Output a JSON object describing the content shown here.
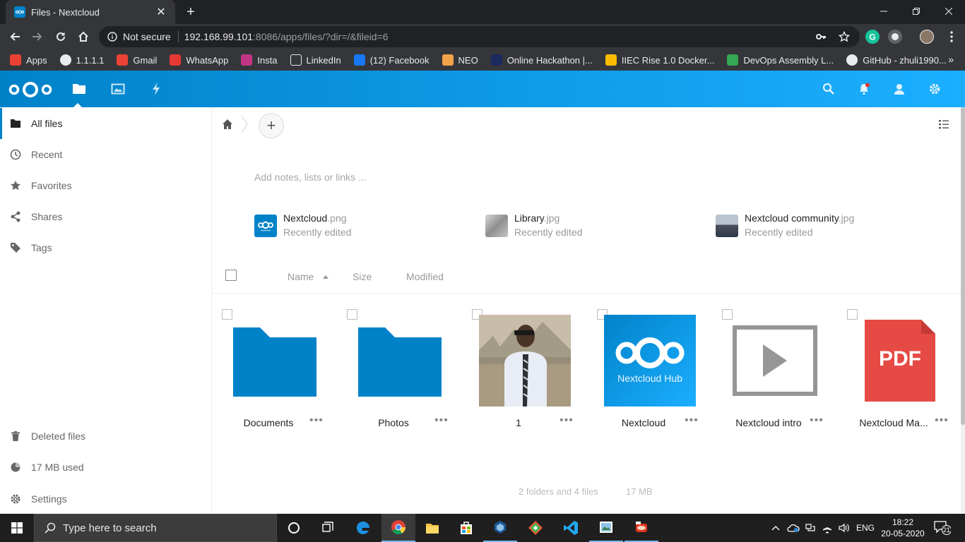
{
  "browser": {
    "tab_title": "Files - Nextcloud",
    "tab_close": "✕",
    "new_tab": "+",
    "security_label": "Not secure",
    "url_host": "192.168.99.101",
    "url_rest": ":8086/apps/files/?dir=/&fileid=6",
    "bookmarks": [
      {
        "label": "Apps",
        "icon": "apps-grid-icon",
        "color": "#e94235"
      },
      {
        "label": "1.1.1.1",
        "icon": "globe-icon",
        "color": "#e8eaed"
      },
      {
        "label": "Gmail",
        "icon": "gmail-icon",
        "color": "#ea4335"
      },
      {
        "label": "WhatsApp",
        "icon": "whatsapp-icon",
        "color": "#e53935"
      },
      {
        "label": "Insta",
        "icon": "instagram-icon",
        "color": "#c13584"
      },
      {
        "label": "LinkedIn",
        "icon": "linkedin-icon",
        "color": "#35363a"
      },
      {
        "label": "(12) Facebook",
        "icon": "facebook-icon",
        "color": "#1877f2"
      },
      {
        "label": "NEO",
        "icon": "neo-icon",
        "color": "#f2a24a"
      },
      {
        "label": "Online Hackathon |...",
        "icon": "hackathon-icon",
        "color": "#1c2b5e"
      },
      {
        "label": "IIEC Rise 1.0 Docker...",
        "icon": "drive-icon",
        "color": "#fbbc04"
      },
      {
        "label": "DevOps Assembly L...",
        "icon": "drive-icon",
        "color": "#34a853"
      },
      {
        "label": "GitHub - zhuli1990...",
        "icon": "github-icon",
        "color": "#e8eaed"
      }
    ],
    "bookmarks_more": "»"
  },
  "nextcloud": {
    "sidebar": {
      "items": [
        {
          "label": "All files",
          "icon": "folder-icon",
          "active": true
        },
        {
          "label": "Recent",
          "icon": "clock-icon"
        },
        {
          "label": "Favorites",
          "icon": "star-icon"
        },
        {
          "label": "Shares",
          "icon": "share-icon"
        },
        {
          "label": "Tags",
          "icon": "tag-icon"
        }
      ],
      "bottom": [
        {
          "label": "Deleted files",
          "icon": "trash-icon"
        },
        {
          "label": "17 MB used",
          "icon": "quota-icon"
        },
        {
          "label": "Settings",
          "icon": "gear-icon"
        }
      ]
    },
    "add_label": "+",
    "notes_placeholder": "Add notes, lists or links ...",
    "recent": [
      {
        "base": "Nextcloud",
        "ext": ".png",
        "sub": "Recently edited",
        "thumb": "nextcloud"
      },
      {
        "base": "Library",
        "ext": ".jpg",
        "sub": "Recently edited",
        "thumb": "photo-gray"
      },
      {
        "base": "Nextcloud community",
        "ext": ".jpg",
        "sub": "Recently edited",
        "thumb": "photo-crowd"
      }
    ],
    "columns": {
      "name": "Name",
      "size": "Size",
      "modified": "Modified"
    },
    "files": [
      {
        "label": "Documents",
        "kind": "folder"
      },
      {
        "label": "Photos",
        "kind": "folder"
      },
      {
        "label": "1",
        "kind": "photo"
      },
      {
        "label": "Nextcloud",
        "kind": "nextcloud-hub",
        "hub_text": "Nextcloud Hub"
      },
      {
        "label": "Nextcloud intro",
        "kind": "video"
      },
      {
        "label": "Nextcloud Ma...",
        "kind": "pdf",
        "pdf_text": "PDF"
      }
    ],
    "more_label": "•••",
    "summary": "2 folders and 4 files",
    "summary_size": "17 MB"
  },
  "taskbar": {
    "search_placeholder": "Type here to search",
    "language": "ENG",
    "time": "18:22",
    "date": "20-05-2020",
    "notification_count": "21"
  },
  "colors": {
    "accent": "#0082c9",
    "folder": "#0082c9",
    "pdf": "#e64a45"
  }
}
